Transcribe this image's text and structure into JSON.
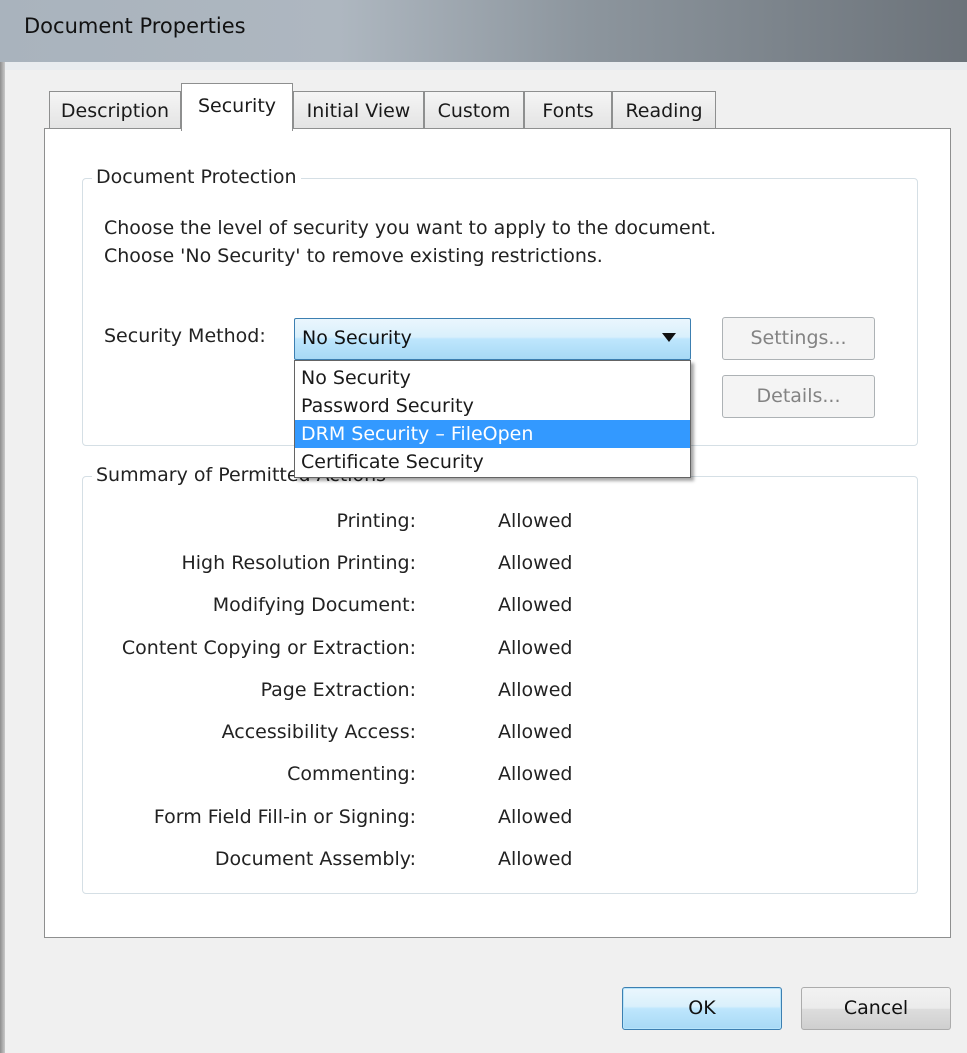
{
  "window": {
    "title": "Document Properties"
  },
  "tabs": [
    {
      "label": "Description",
      "active": false
    },
    {
      "label": "Security",
      "active": true
    },
    {
      "label": "Initial View",
      "active": false
    },
    {
      "label": "Custom",
      "active": false
    },
    {
      "label": "Fonts",
      "active": false
    },
    {
      "label": "Reading",
      "active": false
    }
  ],
  "protection": {
    "legend": "Document Protection",
    "line1": "Choose the level of security you want to apply to the document.",
    "line2": "Choose 'No Security' to remove existing restrictions.",
    "method_label": "Security Method:",
    "method_value": "No Security",
    "options": [
      "No Security",
      "Password Security",
      "DRM Security – FileOpen",
      "Certificate Security"
    ],
    "highlighted_option": "DRM Security – FileOpen",
    "settings_label": "Settings...",
    "details_label": "Details..."
  },
  "summary": {
    "legend": "Summary of Permitted Actions",
    "rows": [
      {
        "name": "Printing:",
        "value": "Allowed"
      },
      {
        "name": "High Resolution Printing:",
        "value": "Allowed"
      },
      {
        "name": "Modifying Document:",
        "value": "Allowed"
      },
      {
        "name": "Content Copying or Extraction:",
        "value": "Allowed"
      },
      {
        "name": "Page Extraction:",
        "value": "Allowed"
      },
      {
        "name": "Accessibility Access:",
        "value": "Allowed"
      },
      {
        "name": "Commenting:",
        "value": "Allowed"
      },
      {
        "name": "Form Field Fill-in or Signing:",
        "value": "Allowed"
      },
      {
        "name": "Document Assembly:",
        "value": "Allowed"
      }
    ]
  },
  "buttons": {
    "ok": "OK",
    "cancel": "Cancel"
  },
  "colors": {
    "selection": "#3399ff",
    "focus_border": "#3c7fb1"
  }
}
